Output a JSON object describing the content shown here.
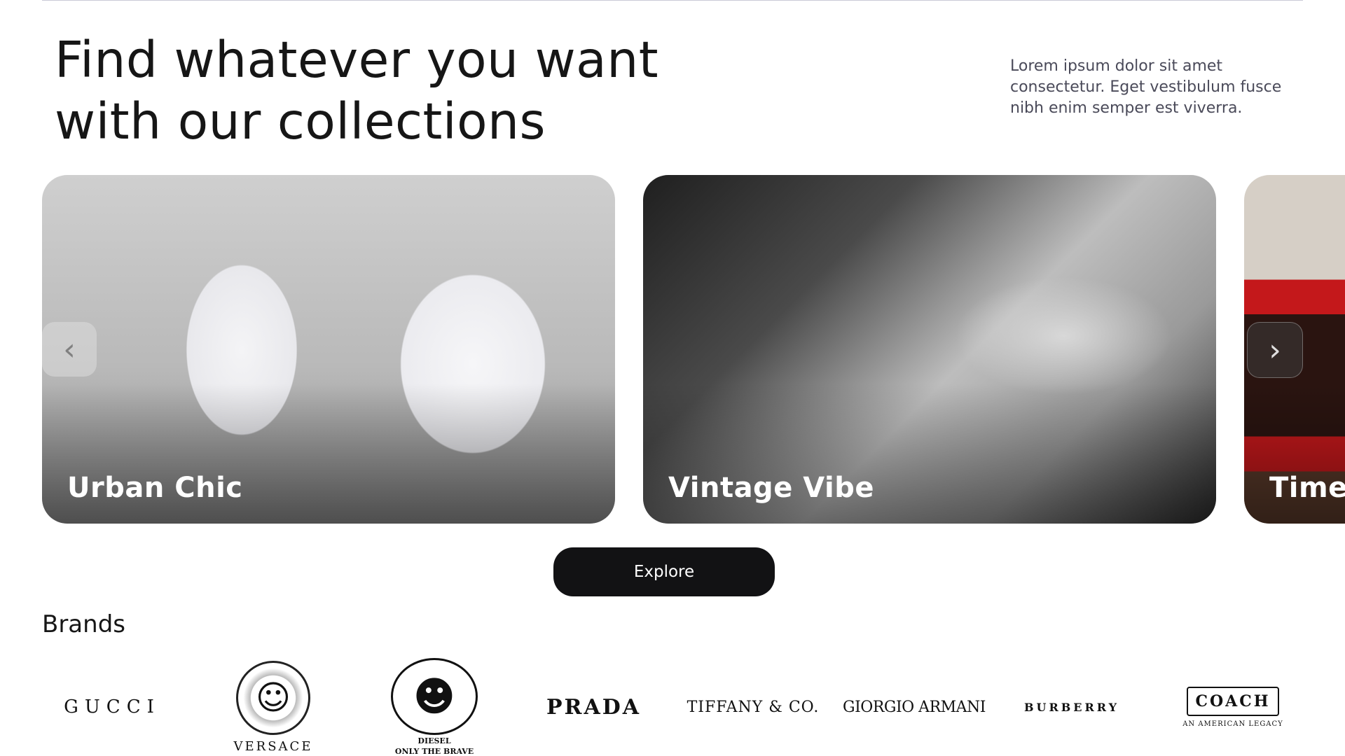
{
  "hero": {
    "title": "Find whatever you want with our collections",
    "subtitle": "Lorem ipsum dolor sit amet consectetur. Eget vestibulum fusce nibh enim semper est viverra."
  },
  "carousel": {
    "cards": [
      {
        "label": "Urban Chic"
      },
      {
        "label": "Vintage Vibe"
      },
      {
        "label": "Timele"
      }
    ],
    "prev_icon": "chevron-left-icon",
    "next_icon": "chevron-right-icon",
    "prev_glyph": "‹",
    "next_glyph": "›"
  },
  "explore_button": "Explore",
  "brands": {
    "title": "Brands",
    "items": [
      {
        "name": "GUCCI"
      },
      {
        "name": "VERSACE"
      },
      {
        "name": "DIESEL",
        "ring": "ONLY THE BRAVE"
      },
      {
        "name": "PRADA"
      },
      {
        "name": "TIFFANY & CO."
      },
      {
        "name": "GIORGIO ARMANI"
      },
      {
        "name": "BURBERRY"
      },
      {
        "name": "COACH",
        "tagline": "AN AMERICAN LEGACY"
      }
    ]
  }
}
